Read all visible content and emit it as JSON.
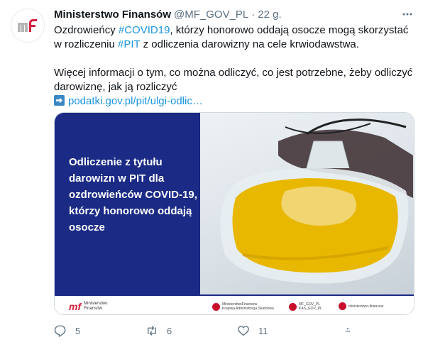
{
  "tweet": {
    "author_name": "Ministerstwo Finansów",
    "handle": "@MF_GOV_PL",
    "separator": "·",
    "time": "22 g.",
    "avatar_logo": "mf",
    "text": {
      "line1_pre": "Ozdrowieńcy ",
      "hashtag1": "#COVID19",
      "line1_post": ", którzy honorowo oddają osocze mogą skorzystać w rozliczeniu ",
      "hashtag2": "#PIT",
      "line1_end": " z odliczenia darowizny na cele krwiodawstwa.",
      "paragraph2": "Więcej informacji o tym, co można odliczyć, co jest potrzebne, żeby odliczyć darowiznę, jak ją rozliczyć",
      "link": "podatki.gov.pl/pit/ulgi-odlic…"
    },
    "media": {
      "headline": "Odliczenie z tytułu darowizn w PIT dla ozdrowieńców COVID-19, którzy honorowo oddają osocze",
      "footer_logo_mark": "mf",
      "footer_logo_label1": "Ministerstwo",
      "footer_logo_label2": "Finansów",
      "social": [
        {
          "icon": "youtube-icon",
          "line1": "MinisterstwoFinansow",
          "line2": "Krajowa Administracja Skarbowa"
        },
        {
          "icon": "twitter-icon",
          "line1": "MF_GOV_PL",
          "line2": "KAS_GOV_PL"
        },
        {
          "icon": "linkedin-icon",
          "line1": "ministerstwo-finansow",
          "line2": ""
        }
      ]
    },
    "actions": {
      "reply_count": "5",
      "retweet_count": "6",
      "like_count": "11"
    }
  },
  "colors": {
    "link": "#1b95e0",
    "media_blue": "#1a2a85",
    "brand_red": "#d4213d",
    "muted": "#5b7083"
  }
}
